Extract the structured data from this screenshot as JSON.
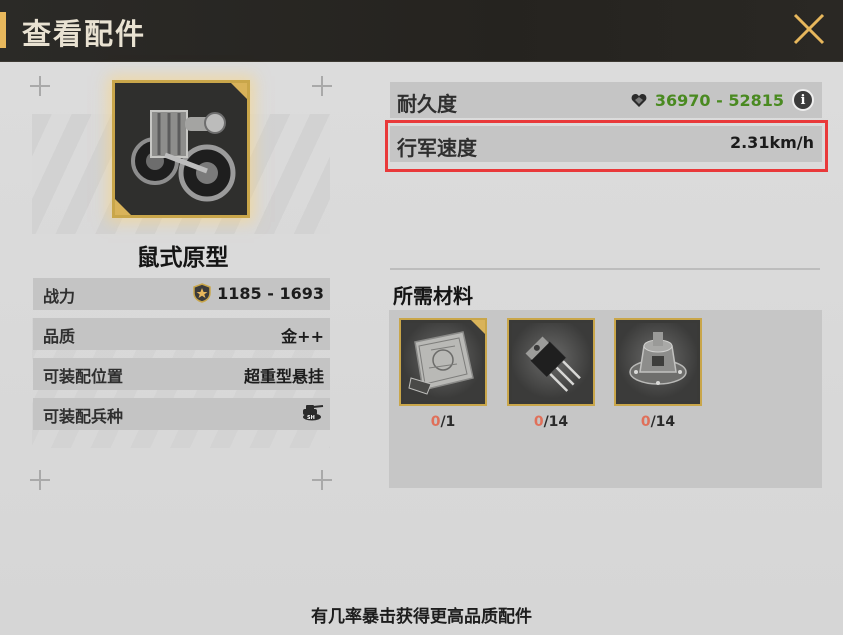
{
  "header": {
    "title": "查看配件"
  },
  "item": {
    "name": "鼠式原型"
  },
  "stats": [
    {
      "label": "战力",
      "value": "1185 - 1693",
      "icon": "star-shield-icon"
    },
    {
      "label": "品质",
      "value": "金++"
    },
    {
      "label": "可装配位置",
      "value": "超重型悬挂"
    },
    {
      "label": "可装配兵种",
      "value": "",
      "icon": "sh-tank-icon"
    }
  ],
  "attributes": {
    "durability": {
      "label": "耐久度",
      "value": "36970 - 52815",
      "icon": "heart-icon"
    },
    "march_speed": {
      "label": "行军速度",
      "value": "2.31km/h"
    }
  },
  "materials": {
    "title": "所需材料",
    "items": [
      {
        "icon": "blueprint-icon",
        "have": "0",
        "need": "/1"
      },
      {
        "icon": "transistor-icon",
        "have": "0",
        "need": "/14"
      },
      {
        "icon": "differential-gear-icon",
        "have": "0",
        "need": "/14"
      }
    ]
  },
  "footer": {
    "hint": "有几率暴击获得更高品质配件"
  },
  "colors": {
    "accent_gold": "#e7b75c",
    "durability_green": "#4a8a21",
    "highlight_red": "#e9393a",
    "count_red": "#e0705a"
  }
}
